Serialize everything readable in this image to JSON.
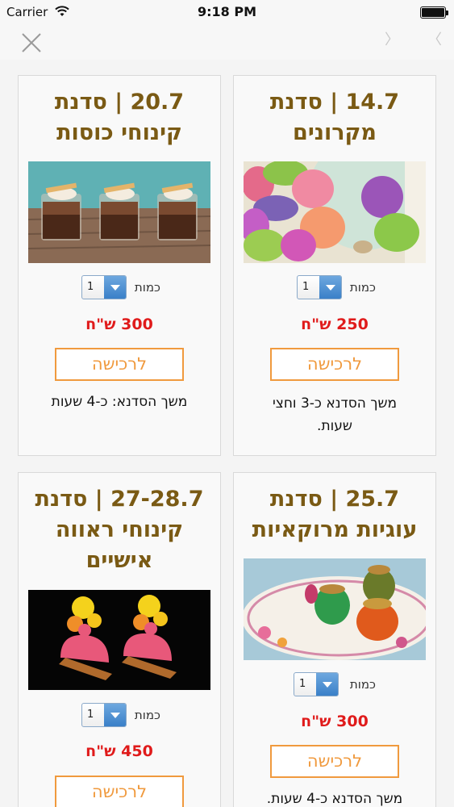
{
  "status_bar": {
    "carrier": "Carrier",
    "time": "9:18 PM"
  },
  "nav": {
    "close_icon": "close-x-icon",
    "back_icon": "chevron-left-icon",
    "forward_icon": "chevron-right-icon"
  },
  "colors": {
    "title": "#7a5a14",
    "price": "#e01b1b",
    "button": "#f09a3e",
    "select_arrow": "#3a80c8"
  },
  "products": [
    {
      "title_line1": "14.7 | סדנת",
      "title_line2": "מקרונים",
      "title_line3": "",
      "qty_label": "כמות",
      "qty_value": "1",
      "price": "250 ש\"ח",
      "buy_label": "לרכישה",
      "duration_line1": "משך הסדנא כ-3 וחצי",
      "duration_line2": "שעות."
    },
    {
      "title_line1": "20.7 | סדנת",
      "title_line2": "קינוחי כוסות",
      "title_line3": "",
      "qty_label": "כמות",
      "qty_value": "1",
      "price": "300 ש\"ח",
      "buy_label": "לרכישה",
      "duration_line1": "משך הסדנא: כ-4 שעות",
      "duration_line2": ""
    },
    {
      "title_line1": "25.7 | סדנת",
      "title_line2": "עוגיות מרוקאיות",
      "title_line3": "",
      "qty_label": "כמות",
      "qty_value": "1",
      "price": "300 ש\"ח",
      "buy_label": "לרכישה",
      "duration_line1": "משך הסדנא כ-4 שעות.",
      "duration_line2": ""
    },
    {
      "title_line1": "27-28.7 | סדנת",
      "title_line2": "קינוחי ראווה",
      "title_line3": "אישיים",
      "qty_label": "כמות",
      "qty_value": "1",
      "price": "450 ש\"ח",
      "buy_label": "לרכישה",
      "duration_line1": "",
      "duration_line2": ""
    }
  ]
}
